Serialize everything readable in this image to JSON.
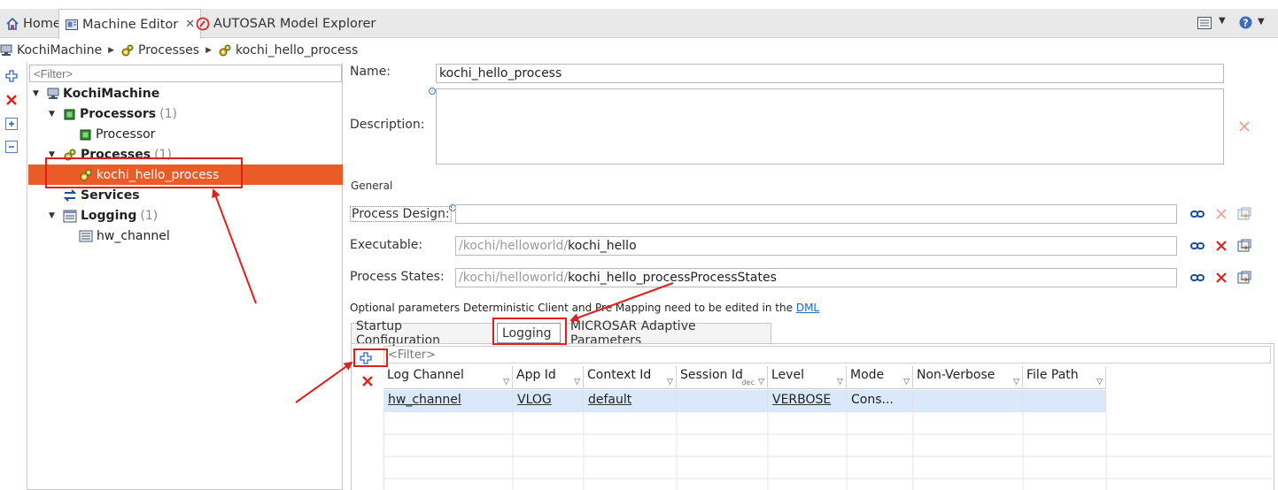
{
  "tabs": [
    {
      "label": "Home",
      "icon": "home-icon"
    },
    {
      "label": "Machine Editor",
      "icon": "machine-editor-icon"
    },
    {
      "label": "AUTOSAR Model Explorer",
      "icon": "autosar-icon"
    }
  ],
  "breadcrumb": [
    "KochiMachine",
    "Processes",
    "kochi_hello_process"
  ],
  "tree": {
    "filter_placeholder": "<Filter>",
    "root": "KochiMachine",
    "processors": {
      "label": "Processors",
      "count": "(1)"
    },
    "processor": "Processor",
    "processes": {
      "label": "Processes",
      "count": "(1)"
    },
    "selected_process": "kochi_hello_process",
    "services": "Services",
    "logging": {
      "label": "Logging",
      "count": "(1)"
    },
    "hw_channel": "hw_channel"
  },
  "form": {
    "name_label": "Name:",
    "name_value": "kochi_hello_process",
    "description_label": "Description:",
    "description_value": "",
    "general_heading": "General",
    "process_design_label": "Process Design:",
    "process_design_value": "",
    "executable_label": "Executable:",
    "executable_path": "/kochi/helloworld/",
    "executable_name": "kochi_hello",
    "process_states_label": "Process States:",
    "process_states_path": "/kochi/helloworld/",
    "process_states_name": "kochi_hello_processProcessStates",
    "optional_note": "Optional parameters Deterministic Client and Pre Mapping need to be edited in the",
    "dml_link": "DML"
  },
  "subtabs": [
    "Startup Configuration",
    "Logging",
    "MICROSAR Adaptive Parameters"
  ],
  "logging_table": {
    "filter_placeholder": "<Filter>",
    "columns": [
      "Log Channel",
      "App Id",
      "Context Id",
      "Session Id",
      "Level",
      "Mode",
      "Non-Verbose",
      "File Path"
    ],
    "session_id_hint": "dec",
    "rows": [
      {
        "log_channel": "hw_channel",
        "app_id": "VLOG",
        "context_id": "default",
        "session_id": "",
        "level": "VERBOSE",
        "mode": "Cons...",
        "non_verbose": "",
        "file_path": ""
      }
    ]
  },
  "colors": {
    "selection": "#ea5b27",
    "annotation_red": "#e0201f",
    "row_highlight": "#d9e8fb",
    "link_blue": "#1b6ac9"
  }
}
